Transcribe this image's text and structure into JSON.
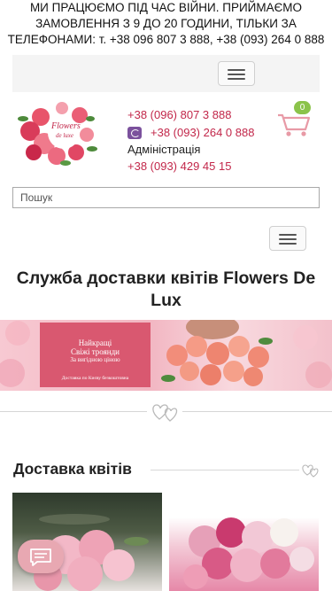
{
  "announcement": "МИ ПРАЦЮЄМО ПІД ЧАС ВІЙНИ. ПРИЙМАЄМО ЗАМОВЛЕННЯ З 9 ДО 20 ГОДИНИ, ТІЛЬКИ ЗА ТЕЛЕФОНАМИ: т. +38 096 807 3 888, +38 (093) 264 0 888",
  "logo": {
    "text_line1": "Flowers",
    "text_line2": "de luxe"
  },
  "contacts": {
    "phone1": "+38 (096) 807 3 888",
    "phone2": "+38 (093) 264 0 888",
    "admin_label": "Адміністрація",
    "admin_phone": "+38 (093) 429 45 15"
  },
  "cart": {
    "count": "0"
  },
  "search": {
    "placeholder": "Пошук",
    "value": ""
  },
  "page_title": "Служба доставки квітів Flowers De Lux",
  "banner": {
    "line1": "Найкращі",
    "line2": "Свіжі троянди",
    "line3": "За вигідною ціною",
    "line4": "Доставка по Києву безкоштовна"
  },
  "section": {
    "title": "Доставка квітів"
  },
  "colors": {
    "accent": "#c2274a",
    "badge": "#8bc34a",
    "viber": "#7b519d",
    "chat": "#e8a8b2"
  },
  "icons": [
    "menu-icon",
    "viber-icon",
    "cart-icon",
    "hearts-divider-icon",
    "chat-icon"
  ]
}
